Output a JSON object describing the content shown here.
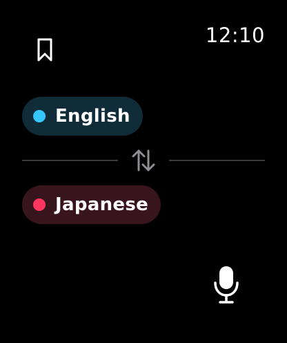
{
  "status": {
    "time": "12:10"
  },
  "toolbar": {
    "bookmark_icon": "bookmark-icon"
  },
  "source_language": {
    "label": "English",
    "dot_color": "#34c8ff",
    "pill_color": "#0f2c38"
  },
  "swap": {
    "icon": "swap-arrows-icon"
  },
  "target_language": {
    "label": "Japanese",
    "dot_color": "#ff375f",
    "pill_color": "#38141d"
  },
  "mic": {
    "icon": "microphone-icon"
  }
}
